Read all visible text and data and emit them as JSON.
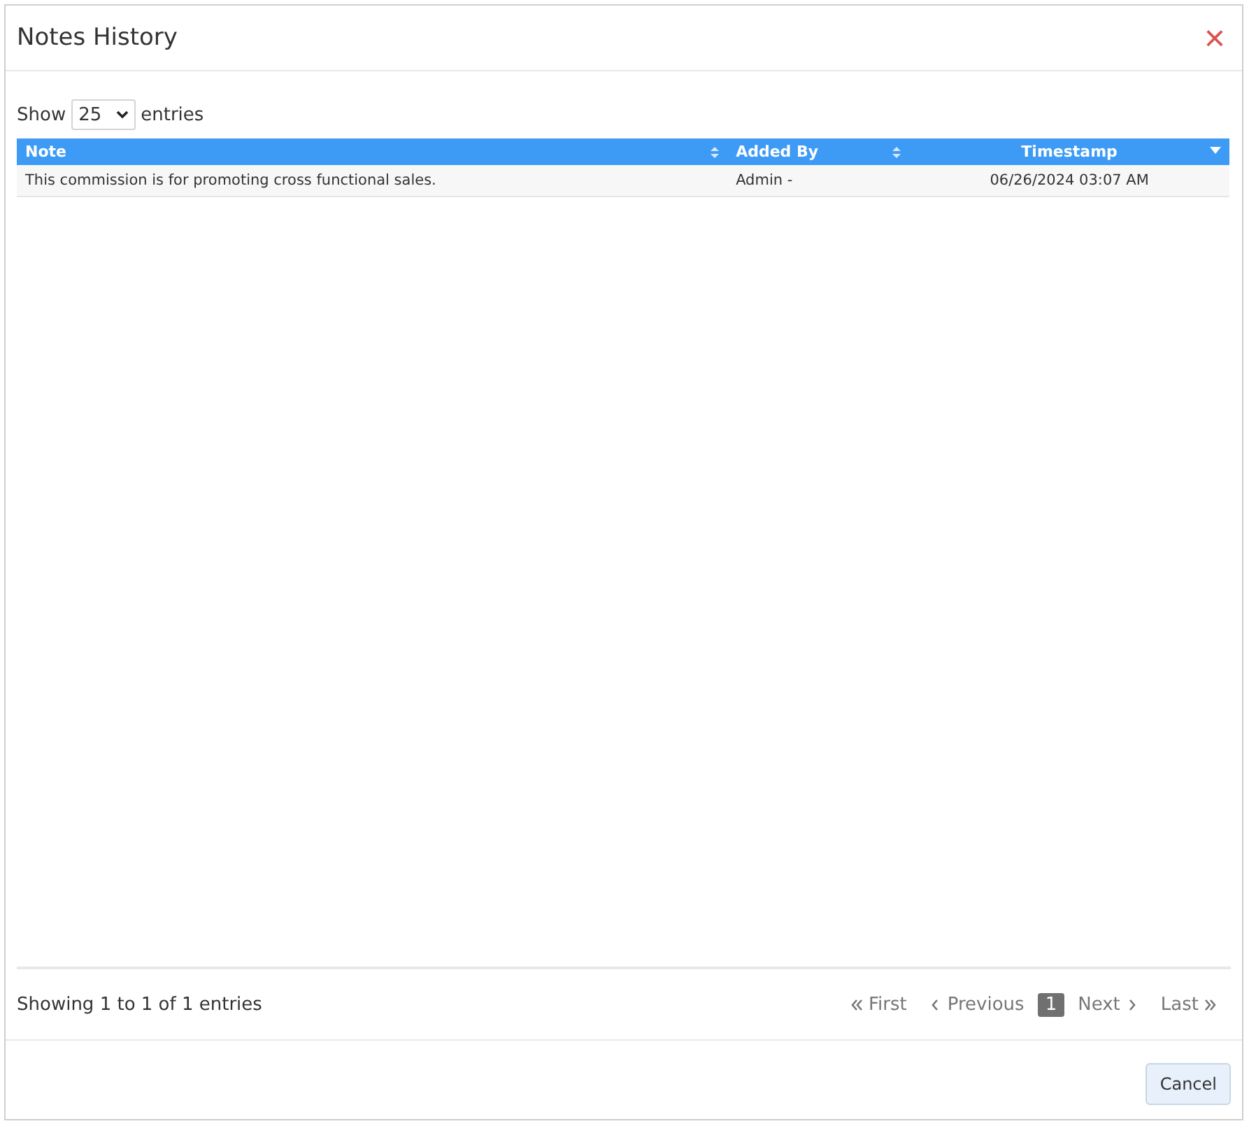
{
  "dialog": {
    "title": "Notes History",
    "close": "×"
  },
  "length": {
    "before": "Show",
    "value": "25",
    "after": "entries"
  },
  "table": {
    "columns": [
      {
        "label": "Note",
        "sorted": false
      },
      {
        "label": "Added By",
        "sorted": false
      },
      {
        "label": "Timestamp",
        "sorted": true
      }
    ],
    "rows": [
      {
        "cells": [
          "This commission is for promoting cross functional sales.",
          "Admin -",
          "06/26/2024 03:07 AM"
        ]
      }
    ]
  },
  "info": "Showing 1 to 1 of 1 entries",
  "pagination": [
    {
      "kind": "first",
      "label": "First",
      "selected": false
    },
    {
      "kind": "previous",
      "label": "Previous",
      "selected": false
    },
    {
      "kind": "page",
      "label": "1",
      "selected": true
    },
    {
      "kind": "next",
      "label": "Next",
      "selected": false
    },
    {
      "kind": "last",
      "label": "Last",
      "selected": false
    }
  ],
  "buttons": [
    "Cancel"
  ]
}
